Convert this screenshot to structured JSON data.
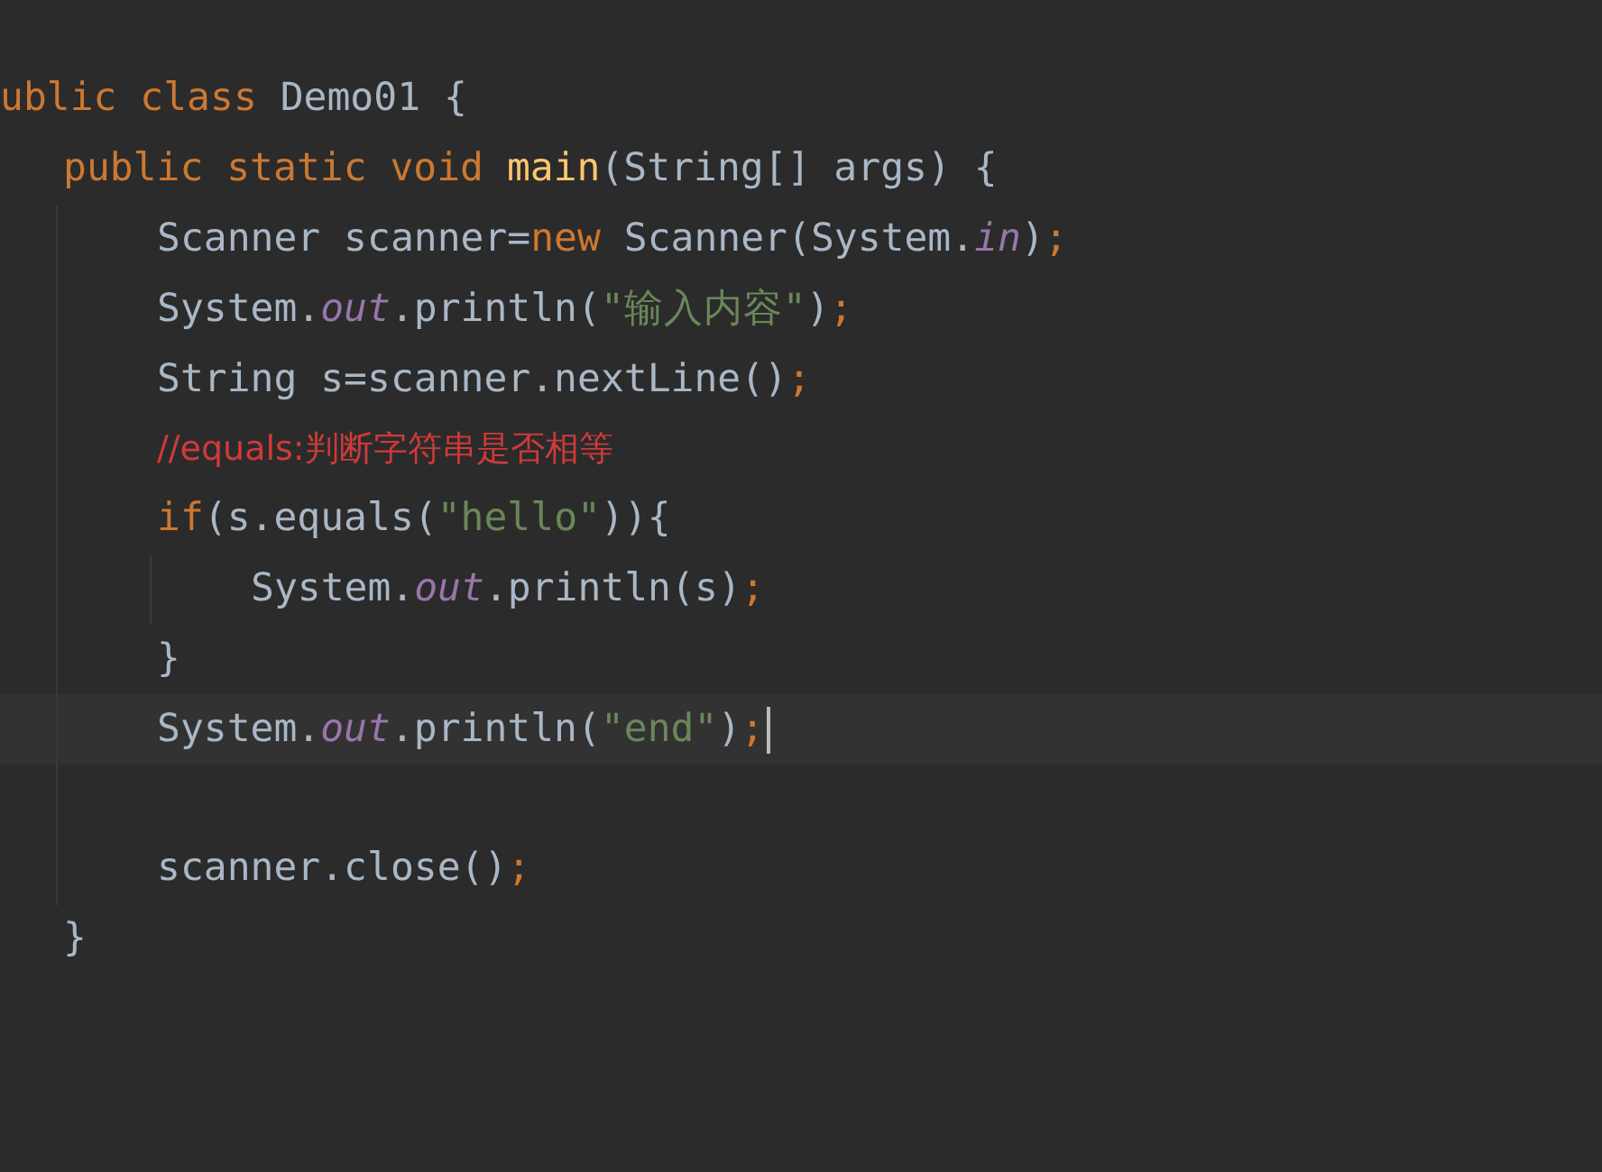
{
  "editor": {
    "lines": [
      {
        "kind": "code",
        "tokens": [
          {
            "kind": "keyword",
            "text": "ublic class "
          },
          {
            "kind": "plain",
            "text": "Demo01 {"
          }
        ],
        "children": [
          {
            "kind": "code",
            "tokens": [
              {
                "kind": "keyword",
                "text": "public static void "
              },
              {
                "kind": "method",
                "text": "main"
              },
              {
                "kind": "plain",
                "text": "(String[] args) {"
              }
            ],
            "children": [
              {
                "kind": "code",
                "tokens": [
                  {
                    "kind": "plain",
                    "text": "Scanner scanner="
                  },
                  {
                    "kind": "keyword",
                    "text": "new "
                  },
                  {
                    "kind": "plain",
                    "text": "Scanner(System."
                  },
                  {
                    "kind": "field",
                    "text": "in"
                  },
                  {
                    "kind": "plain",
                    "text": ")"
                  },
                  {
                    "kind": "keyword",
                    "text": ";"
                  }
                ]
              },
              {
                "kind": "code",
                "tokens": [
                  {
                    "kind": "plain",
                    "text": "System."
                  },
                  {
                    "kind": "field",
                    "text": "out"
                  },
                  {
                    "kind": "plain",
                    "text": ".println("
                  },
                  {
                    "kind": "string",
                    "text": "\"输入内容\""
                  },
                  {
                    "kind": "plain",
                    "text": ")"
                  },
                  {
                    "kind": "keyword",
                    "text": ";"
                  }
                ]
              },
              {
                "kind": "code",
                "tokens": [
                  {
                    "kind": "plain",
                    "text": "String s=scanner.nextLine()"
                  },
                  {
                    "kind": "keyword",
                    "text": ";"
                  }
                ]
              },
              {
                "kind": "code",
                "tokens": [
                  {
                    "kind": "comment",
                    "text": "//equals:判断字符串是否相等"
                  }
                ]
              },
              {
                "kind": "code",
                "tokens": [
                  {
                    "kind": "keyword",
                    "text": "if"
                  },
                  {
                    "kind": "plain",
                    "text": "(s.equals("
                  },
                  {
                    "kind": "string",
                    "text": "\"hello\""
                  },
                  {
                    "kind": "plain",
                    "text": ")){"
                  }
                ],
                "children": [
                  {
                    "kind": "code",
                    "tokens": [
                      {
                        "kind": "plain",
                        "text": "System."
                      },
                      {
                        "kind": "field",
                        "text": "out"
                      },
                      {
                        "kind": "plain",
                        "text": ".println(s)"
                      },
                      {
                        "kind": "keyword",
                        "text": ";"
                      }
                    ]
                  }
                ]
              },
              {
                "kind": "code",
                "tokens": [
                  {
                    "kind": "plain",
                    "text": "}"
                  }
                ]
              },
              {
                "kind": "code",
                "current": true,
                "tokens": [
                  {
                    "kind": "plain",
                    "text": "System."
                  },
                  {
                    "kind": "field",
                    "text": "out"
                  },
                  {
                    "kind": "plain",
                    "text": ".println("
                  },
                  {
                    "kind": "string",
                    "text": "\"end\""
                  },
                  {
                    "kind": "plain",
                    "text": ")"
                  },
                  {
                    "kind": "keyword",
                    "text": ";"
                  }
                ]
              },
              {
                "kind": "blank"
              },
              {
                "kind": "code",
                "tokens": [
                  {
                    "kind": "plain",
                    "text": "scanner.close()"
                  },
                  {
                    "kind": "keyword",
                    "text": ";"
                  }
                ]
              }
            ]
          },
          {
            "kind": "code",
            "tokens": [
              {
                "kind": "plain",
                "text": "}"
              }
            ]
          }
        ]
      }
    ]
  }
}
